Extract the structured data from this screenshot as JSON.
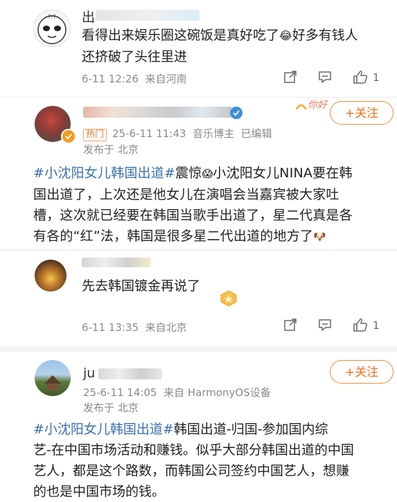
{
  "comments": [
    {
      "text": "看得出来娱乐圈这碗饭是真好吃了😂好多有钱人还挤破了头往里进",
      "line1": "看得出来娱乐圈这碗饭是真好吃了",
      "emoji": "😂",
      "line1b": "好多有钱人",
      "line2": "还挤破了头往里进",
      "time": "6-11 12:26",
      "location": "来自河南",
      "likes": "1"
    }
  ],
  "post1": {
    "badge": "热门",
    "date": "25-6-11 11:43",
    "role": "音乐博主",
    "edited": "已编辑",
    "published": "发布于 北京",
    "follow_label": "+关注",
    "hashtag": "#小沈阳女儿韩国出道#",
    "body_line1_rest": "震惊",
    "body_line1_b": "小沈阳女儿NINA要在韩",
    "body_line2": "国出道了，上次还是他女儿在演唱会当嘉宾被大家吐",
    "body_line3": "槽，这次就已经要在韩国当歌手出道了，星二代真是各",
    "body_line4": "有各的“红”法，韩国是很多星二代出道的地方了",
    "reply": "先去韩国镀金再说了",
    "reply_time": "6-11 13:35",
    "reply_location": "来自北京",
    "reply_likes": "1"
  },
  "post2": {
    "name_prefix": "ju",
    "date": "25-6-11 14:05",
    "source": "来自 HarmonyOS设备",
    "published": "发布于 北京",
    "follow_label": "+关注",
    "hashtag": "#小沈阳女儿韩国出道#",
    "body_line1_rest": "韩国出道-归国-参加国内综",
    "body_line2": "艺-在中国市场活动和赚钱。似乎大部分韩国出道的中国",
    "body_line3": "艺人，都是这个路数，而韩国公司签约中国艺人，想赚",
    "body_line4": "的也是中国市场的钱。"
  },
  "colors": {
    "accent": "#f06e1b",
    "link": "#3a6fb5",
    "meta": "#8a8a8a"
  }
}
